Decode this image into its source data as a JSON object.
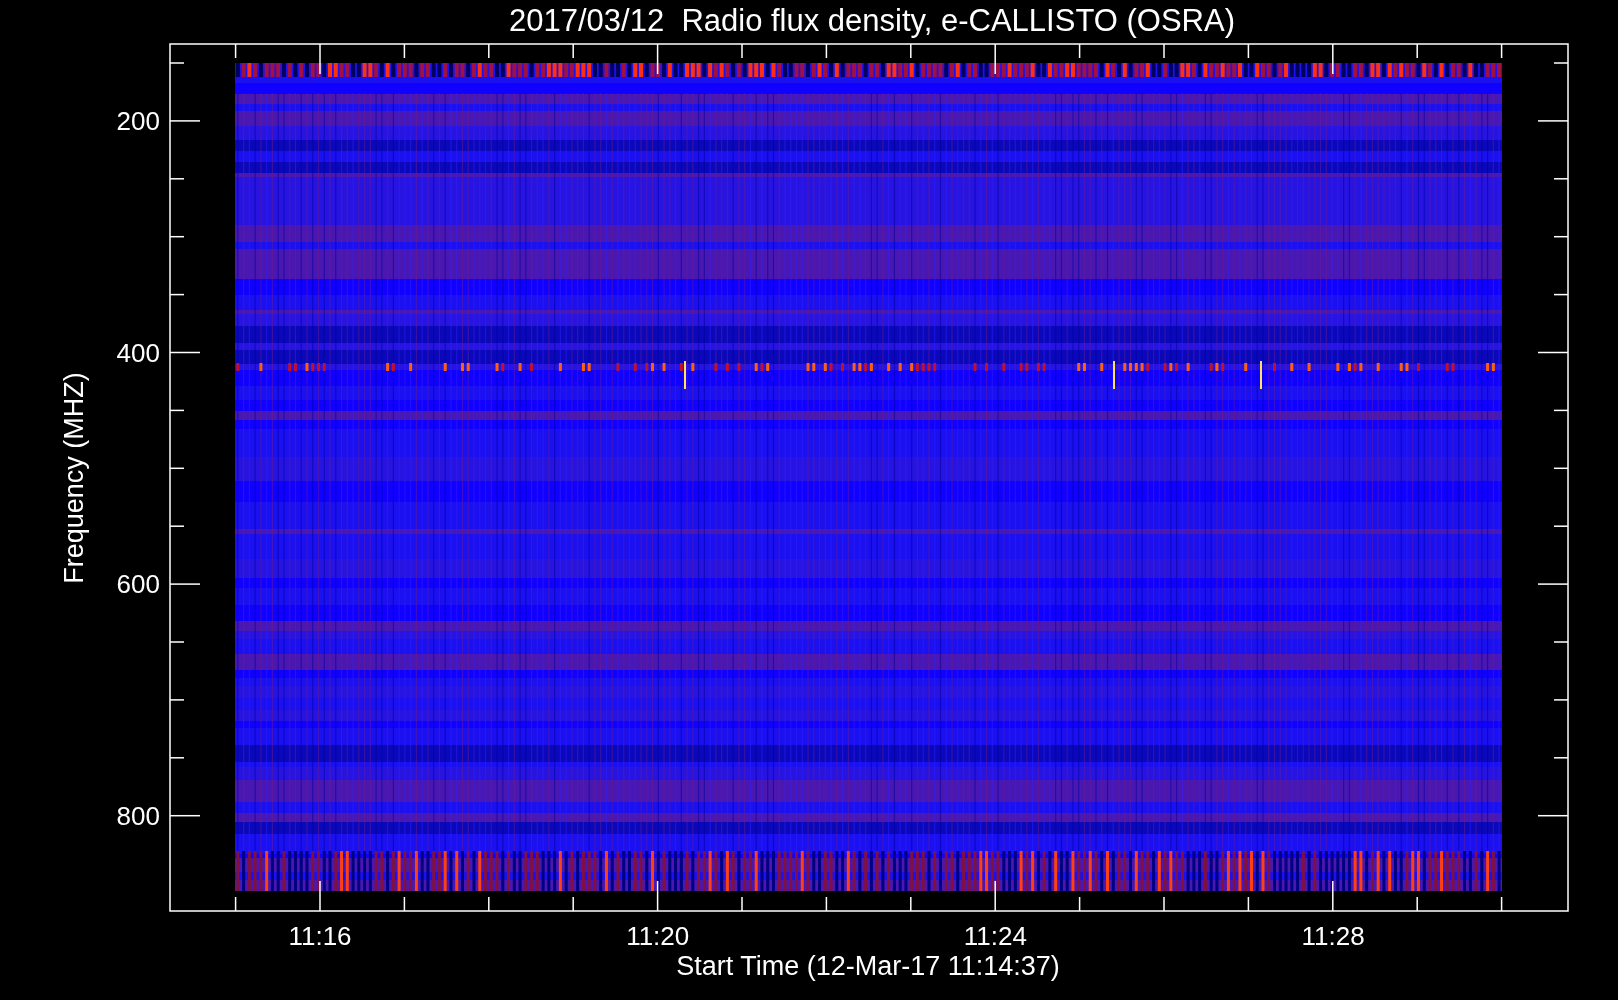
{
  "plot": {
    "title": "2017/03/12  Radio flux density, e-CALLISTO (OSRA)",
    "ylabel": "Frequency (MHZ)",
    "xlabel": "Start Time (12-Mar-17 11:14:37)",
    "yticks": [
      "200",
      "400",
      "600",
      "800"
    ],
    "xticks": [
      "11:16",
      "11:20",
      "11:24",
      "11:28"
    ]
  }
}
